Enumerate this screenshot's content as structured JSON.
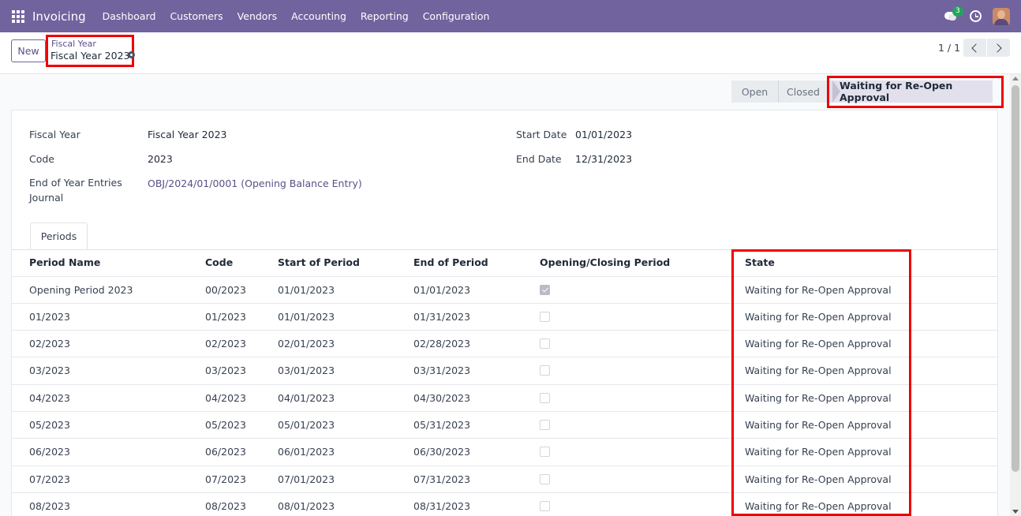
{
  "navbar": {
    "app_name": "Invoicing",
    "menu": [
      "Dashboard",
      "Customers",
      "Vendors",
      "Accounting",
      "Reporting",
      "Configuration"
    ],
    "chat_count": "3",
    "icons": [
      "apps-menu-icon",
      "chat-icon",
      "clock-icon",
      "avatar"
    ]
  },
  "control": {
    "new_label": "New",
    "breadcrumb_parent": "Fiscal Year",
    "breadcrumb_current": "Fiscal Year 2023",
    "pager": "1 / 1"
  },
  "statusbar": {
    "stages": [
      "Open",
      "Closed",
      "Waiting for Re-Open Approval"
    ],
    "active": "Waiting for Re-Open Approval"
  },
  "form": {
    "fiscal_year_label": "Fiscal Year",
    "fiscal_year_value": "Fiscal Year 2023",
    "code_label": "Code",
    "code_value": "2023",
    "journal_label_1": "End of Year Entries",
    "journal_label_2": "Journal",
    "journal_value": "OBJ/2024/01/0001 (Opening Balance Entry)",
    "start_date_label": "Start Date",
    "start_date_value": "01/01/2023",
    "end_date_label": "End Date",
    "end_date_value": "12/31/2023"
  },
  "tabs": [
    "Periods"
  ],
  "periods": {
    "columns": [
      "Period Name",
      "Code",
      "Start of Period",
      "End of Period",
      "Opening/Closing Period",
      "State"
    ],
    "rows": [
      {
        "name": "Opening Period 2023",
        "code": "00/2023",
        "start": "01/01/2023",
        "end": "01/01/2023",
        "opening_closing": true,
        "state": "Waiting for Re-Open Approval"
      },
      {
        "name": "01/2023",
        "code": "01/2023",
        "start": "01/01/2023",
        "end": "01/31/2023",
        "opening_closing": false,
        "state": "Waiting for Re-Open Approval"
      },
      {
        "name": "02/2023",
        "code": "02/2023",
        "start": "02/01/2023",
        "end": "02/28/2023",
        "opening_closing": false,
        "state": "Waiting for Re-Open Approval"
      },
      {
        "name": "03/2023",
        "code": "03/2023",
        "start": "03/01/2023",
        "end": "03/31/2023",
        "opening_closing": false,
        "state": "Waiting for Re-Open Approval"
      },
      {
        "name": "04/2023",
        "code": "04/2023",
        "start": "04/01/2023",
        "end": "04/30/2023",
        "opening_closing": false,
        "state": "Waiting for Re-Open Approval"
      },
      {
        "name": "05/2023",
        "code": "05/2023",
        "start": "05/01/2023",
        "end": "05/31/2023",
        "opening_closing": false,
        "state": "Waiting for Re-Open Approval"
      },
      {
        "name": "06/2023",
        "code": "06/2023",
        "start": "06/01/2023",
        "end": "06/30/2023",
        "opening_closing": false,
        "state": "Waiting for Re-Open Approval"
      },
      {
        "name": "07/2023",
        "code": "07/2023",
        "start": "07/01/2023",
        "end": "07/31/2023",
        "opening_closing": false,
        "state": "Waiting for Re-Open Approval"
      },
      {
        "name": "08/2023",
        "code": "08/2023",
        "start": "08/01/2023",
        "end": "08/31/2023",
        "opening_closing": false,
        "state": "Waiting for Re-Open Approval"
      }
    ]
  },
  "colors": {
    "navbar": "#71639e",
    "highlight_box": "#ee0000",
    "link": "#5b4f86",
    "chat_badge": "#22a45d"
  }
}
